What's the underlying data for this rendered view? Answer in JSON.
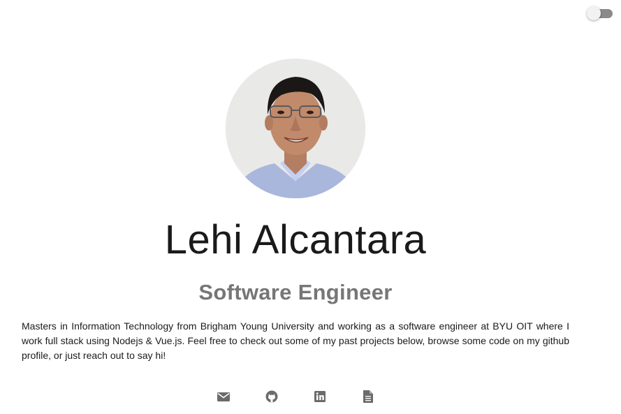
{
  "theme_toggle": {
    "state": "off"
  },
  "profile": {
    "name": "Lehi Alcantara",
    "title": "Software Engineer",
    "bio": "Masters in Information Technology from Brigham Young University and working as a software engineer at BYU OIT where I work full stack using Nodejs & Vue.js. Feel free to check out some of my past projects below, browse some code on my github profile, or just reach out to say hi!"
  },
  "socials": [
    {
      "icon": "email-icon"
    },
    {
      "icon": "github-icon"
    },
    {
      "icon": "linkedin-icon"
    },
    {
      "icon": "resume-icon"
    }
  ],
  "colors": {
    "icon": "#6b6b6b",
    "subtitle": "#767676",
    "toggle_track": "#8a8a8a"
  }
}
